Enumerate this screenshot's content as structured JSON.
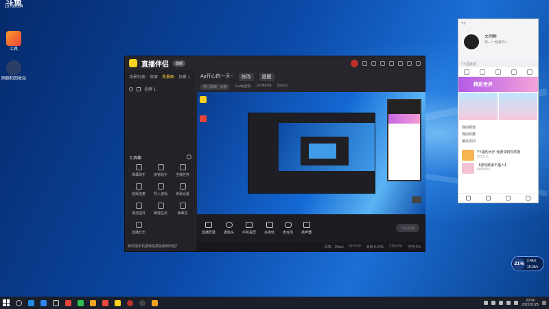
{
  "desktop": {
    "icons": [
      {
        "label": "10780054"
      },
      {
        "label": "工具"
      },
      {
        "label": "网络和回收站"
      }
    ],
    "top_left_text": "斗鱼"
  },
  "app": {
    "name": "直播伴侣",
    "version_badge": "旗舰",
    "sidebar_tabs": [
      "场景列表",
      "双屏",
      "背景图",
      "场景 1"
    ],
    "scene_label": "全屏 1",
    "tools_heading": "工具箱",
    "tools": [
      "弹幕助手",
      "房管助手",
      "主播任务",
      "视频连麦",
      "导入游戏",
      "修改设置",
      "添加插件",
      "赚钱任务",
      "弹幕亮",
      "直播日志"
    ],
    "tip": "如何把手机游戏投屏投稿到伴侣？",
    "stream_title": "Ap开心的一天~",
    "stream_tag_btn": "修改",
    "stream_notice_btn": "提醒",
    "meta": [
      "热门游戏 · 大咖",
      "GoAp回馈",
      "10780054",
      "162611"
    ],
    "controls": [
      "直播屏幕",
      "摄像头",
      "手机投屏",
      "多媒体",
      "麦克风",
      "扬声器"
    ],
    "go_live": "开始直播",
    "status": [
      "码率：0kbps",
      "FPS:60",
      "丢帧:0.00%",
      "CPU:0%",
      "内存:0%",
      "内存"
    ]
  },
  "yy": {
    "window_title": "YY",
    "user_name": "大闹鲜",
    "signature": "你—一有条件~",
    "search_placeholder": "YY直播搜",
    "banner": "精彩世界",
    "list": [
      "我的频道",
      "我的收藏",
      "最近访问"
    ],
    "items": [
      {
        "title": "YY福利大厅-免费领特权奖励",
        "sub": "2717 人"
      },
      {
        "title": "【游戏频道不猫人】",
        "sub": "5668782"
      }
    ]
  },
  "net_widget": {
    "percent": "21%",
    "up": "2.4k/s",
    "down": "16.3k/s"
  },
  "taskbar": {
    "time": "20:54",
    "date": "2022/11/25"
  },
  "colors": {
    "accent": "#ffcf30",
    "app_bg": "#1f1f24",
    "wallpaper": "#0b4aa8"
  }
}
